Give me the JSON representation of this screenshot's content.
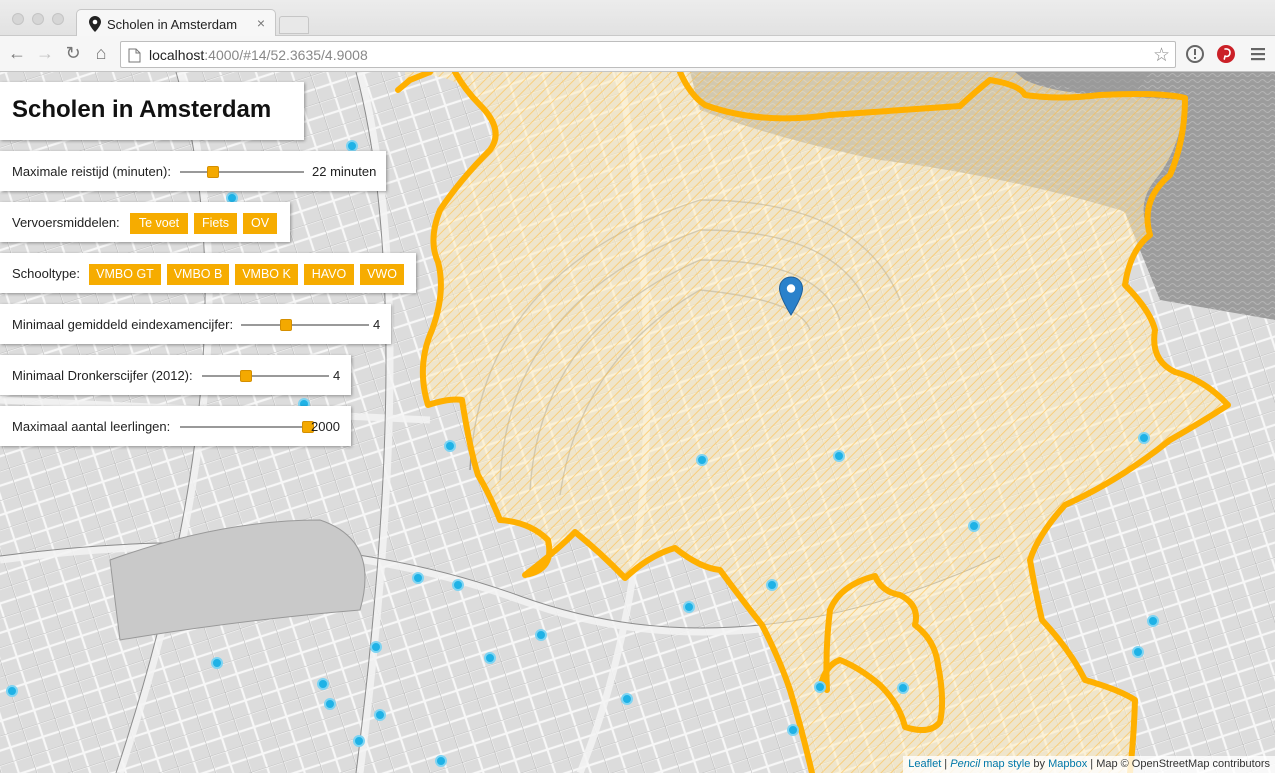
{
  "browser": {
    "tab_title": "Scholen in Amsterdam",
    "tab_close": "×",
    "url_host": "localhost",
    "url_rest": ":4000/#14/52.3635/4.9008",
    "back": "←",
    "forward": "→",
    "reload": "↻",
    "home": "⌂",
    "star": "☆",
    "icons": [
      "page-icon",
      "star-icon",
      "alert-extension-icon",
      "pinterest-extension-icon",
      "menu-icon"
    ]
  },
  "app": {
    "title": "Scholen in Amsterdam"
  },
  "controls": {
    "reistijd": {
      "label": "Maximale reistijd (minuten):",
      "value_text": "22 minuten",
      "level": 0.27
    },
    "vervoer": {
      "label": "Vervoersmiddelen:",
      "options": [
        "Te voet",
        "Fiets",
        "OV"
      ]
    },
    "schooltype": {
      "label": "Schooltype:",
      "options": [
        "VMBO GT",
        "VMBO B",
        "VMBO K",
        "HAVO",
        "VWO"
      ]
    },
    "eindexamen": {
      "label": "Minimaal gemiddeld eindexamencijfer:",
      "value_text": "4",
      "level": 0.35
    },
    "dronkers": {
      "label": "Minimaal Dronkerscijfer (2012):",
      "value_text": "4",
      "level": 0.35
    },
    "leerlingen": {
      "label": "Maximaal aantal leerlingen:",
      "value_text": "2000",
      "level": 1.0
    }
  },
  "attribution": {
    "leaflet": "Leaflet",
    "sep": " | ",
    "pencil": "Pencil",
    "map_style": " map style",
    "by": " by ",
    "mapbox": "Mapbox",
    "osm": " | Map © OpenStreetMap contributors"
  },
  "colors": {
    "accent": "#f6ac00",
    "isochrone": "#ffb000",
    "school_dot": "#1fb2e6",
    "marker": "#2a81cb"
  }
}
